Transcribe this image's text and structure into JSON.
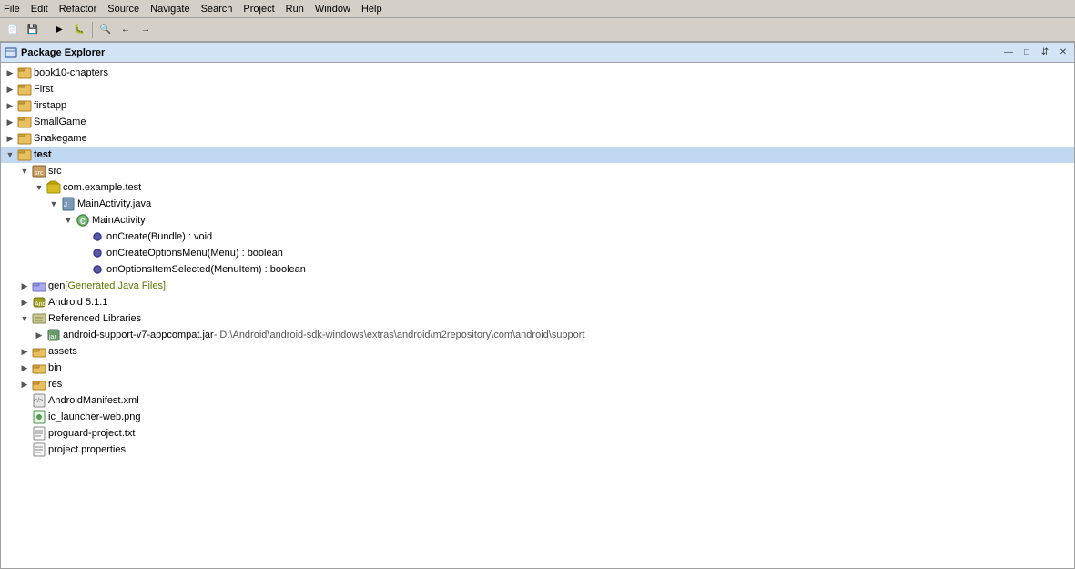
{
  "menubar": {
    "items": [
      "File",
      "Edit",
      "Refactor",
      "Source",
      "Navigate",
      "Search",
      "Project",
      "Run",
      "Window",
      "Help"
    ]
  },
  "panel": {
    "title": "Package Explorer",
    "close_label": "×",
    "minimize_label": "—",
    "maximize_label": "□",
    "restore_label": "↕"
  },
  "tree": {
    "items": [
      {
        "id": "book10",
        "label": "book10-chapters",
        "indent": 0,
        "toggle": "▶",
        "icon": "project"
      },
      {
        "id": "first",
        "label": "First",
        "indent": 0,
        "toggle": "▶",
        "icon": "project"
      },
      {
        "id": "firstapp",
        "label": "firstapp",
        "indent": 0,
        "toggle": "▶",
        "icon": "project"
      },
      {
        "id": "smallgame",
        "label": "SmallGame",
        "indent": 0,
        "toggle": "▶",
        "icon": "project"
      },
      {
        "id": "snakegame",
        "label": "Snakegame",
        "indent": 0,
        "toggle": "▶",
        "icon": "project"
      },
      {
        "id": "test",
        "label": "test",
        "indent": 0,
        "toggle": "▼",
        "icon": "project",
        "selected": true
      },
      {
        "id": "src",
        "label": "src",
        "indent": 1,
        "toggle": "▼",
        "icon": "src"
      },
      {
        "id": "com.example.test",
        "label": "com.example.test",
        "indent": 2,
        "toggle": "▼",
        "icon": "package"
      },
      {
        "id": "mainactivity.java",
        "label": "MainActivity.java",
        "indent": 3,
        "toggle": "▼",
        "icon": "java"
      },
      {
        "id": "mainactivity",
        "label": "MainActivity",
        "indent": 4,
        "toggle": "▼",
        "icon": "class"
      },
      {
        "id": "oncreate",
        "label": "onCreate(Bundle) : void",
        "indent": 5,
        "toggle": "",
        "icon": "method"
      },
      {
        "id": "oncreateoptionsmenu",
        "label": "onCreateOptionsMenu(Menu) : boolean",
        "indent": 5,
        "toggle": "",
        "icon": "method"
      },
      {
        "id": "onoptionsitemselected",
        "label": "onOptionsItemSelected(MenuItem) : boolean",
        "indent": 5,
        "toggle": "",
        "icon": "method"
      },
      {
        "id": "gen",
        "label": "gen",
        "indent": 1,
        "toggle": "▶",
        "icon": "genf",
        "extra": "[Generated Java Files]"
      },
      {
        "id": "android511",
        "label": "Android 5.1.1",
        "indent": 1,
        "toggle": "▶",
        "icon": "android"
      },
      {
        "id": "reflibs",
        "label": "Referenced Libraries",
        "indent": 1,
        "toggle": "▼",
        "icon": "reflibs"
      },
      {
        "id": "appcompat",
        "label": "android-support-v7-appcompat.jar",
        "indent": 2,
        "toggle": "▶",
        "icon": "jar",
        "extra": "- D:\\Android\\android-sdk-windows\\extras\\android\\m2repository\\com\\android\\support"
      },
      {
        "id": "assets",
        "label": "assets",
        "indent": 1,
        "toggle": "▶",
        "icon": "folder"
      },
      {
        "id": "bin",
        "label": "bin",
        "indent": 1,
        "toggle": "▶",
        "icon": "folder"
      },
      {
        "id": "res",
        "label": "res",
        "indent": 1,
        "toggle": "▶",
        "icon": "folder"
      },
      {
        "id": "androidmanifest",
        "label": "AndroidManifest.xml",
        "indent": 1,
        "toggle": "",
        "icon": "xml"
      },
      {
        "id": "iclauncher",
        "label": "ic_launcher-web.png",
        "indent": 1,
        "toggle": "",
        "icon": "png"
      },
      {
        "id": "proguard",
        "label": "proguard-project.txt",
        "indent": 1,
        "toggle": "",
        "icon": "txt"
      },
      {
        "id": "projectprops",
        "label": "project.properties",
        "indent": 1,
        "toggle": "",
        "icon": "txt"
      }
    ]
  }
}
